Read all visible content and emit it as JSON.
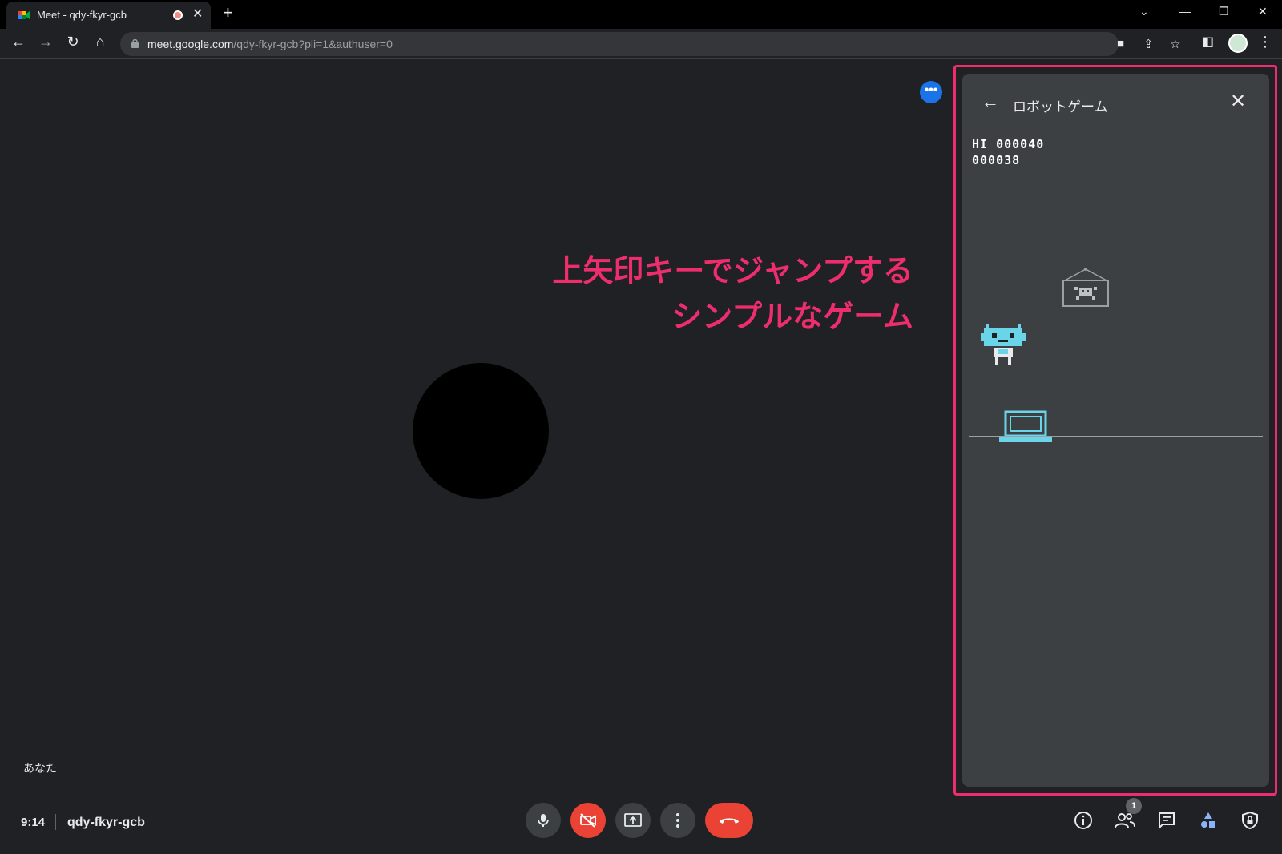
{
  "browser": {
    "tab_title": "Meet - qdy-fkyr-gcb",
    "new_tab_label": "+",
    "url_host": "meet.google.com",
    "url_path": "/qdy-fkyr-gcb?pli=1&authuser=0"
  },
  "stage": {
    "self_name": "あなた",
    "more_label": "•••"
  },
  "annotation": {
    "line1": "上矢印キーでジャンプする",
    "line2": "シンプルなゲーム"
  },
  "panel": {
    "title": "ロボットゲーム",
    "hi_score": "HI 000040",
    "score": "000038"
  },
  "bottom": {
    "time": "9:14",
    "meeting_code": "qdy-fkyr-gcb",
    "participants_count": "1"
  },
  "colors": {
    "accent_annotation": "#ee2d6c",
    "red_control": "#ea4335",
    "blue_button": "#1a73e8"
  }
}
